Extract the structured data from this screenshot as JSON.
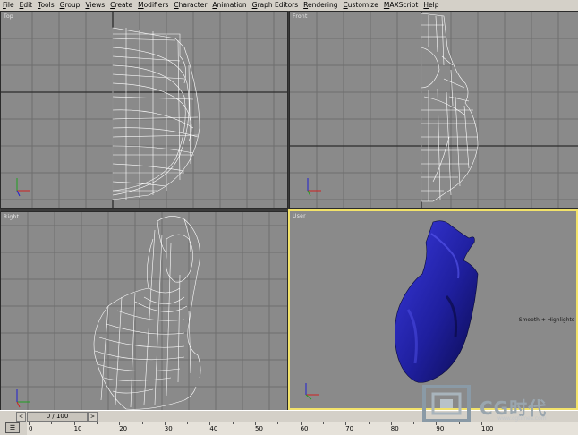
{
  "menu": {
    "items": [
      {
        "u": "F",
        "rest": "ile"
      },
      {
        "u": "E",
        "rest": "dit"
      },
      {
        "u": "T",
        "rest": "ools"
      },
      {
        "u": "G",
        "rest": "roup"
      },
      {
        "u": "V",
        "rest": "iews"
      },
      {
        "u": "C",
        "rest": "reate"
      },
      {
        "u": "M",
        "rest": "odifiers"
      },
      {
        "u": "C",
        "rest": "haracter"
      },
      {
        "u": "A",
        "rest": "nimation"
      },
      {
        "u": "G",
        "rest": "raph Editors"
      },
      {
        "u": "R",
        "rest": "endering"
      },
      {
        "u": "C",
        "rest": "ustomize"
      },
      {
        "u": "M",
        "rest": "AXScript"
      },
      {
        "u": "H",
        "rest": "elp"
      }
    ]
  },
  "viewports": {
    "top": {
      "label": "Top"
    },
    "front": {
      "label": "Front"
    },
    "right": {
      "label": "Right"
    },
    "user": {
      "label": "User",
      "corner_text": "Smooth + Highlights"
    }
  },
  "timeline": {
    "frame_display": "0 / 100",
    "prev_btn": "<",
    "next_btn": ">",
    "ticks": [
      "0",
      "10",
      "20",
      "30",
      "40",
      "50",
      "60",
      "70",
      "80",
      "90",
      "100"
    ]
  },
  "watermark": {
    "brand": "CG时代",
    "sub": "www.cgtimes.com"
  },
  "colors": {
    "viewport_bg": "#8a8a8a",
    "wire": "#ffffff",
    "active_border": "#f2e26a",
    "shaded_model": "#1f1f9e"
  }
}
